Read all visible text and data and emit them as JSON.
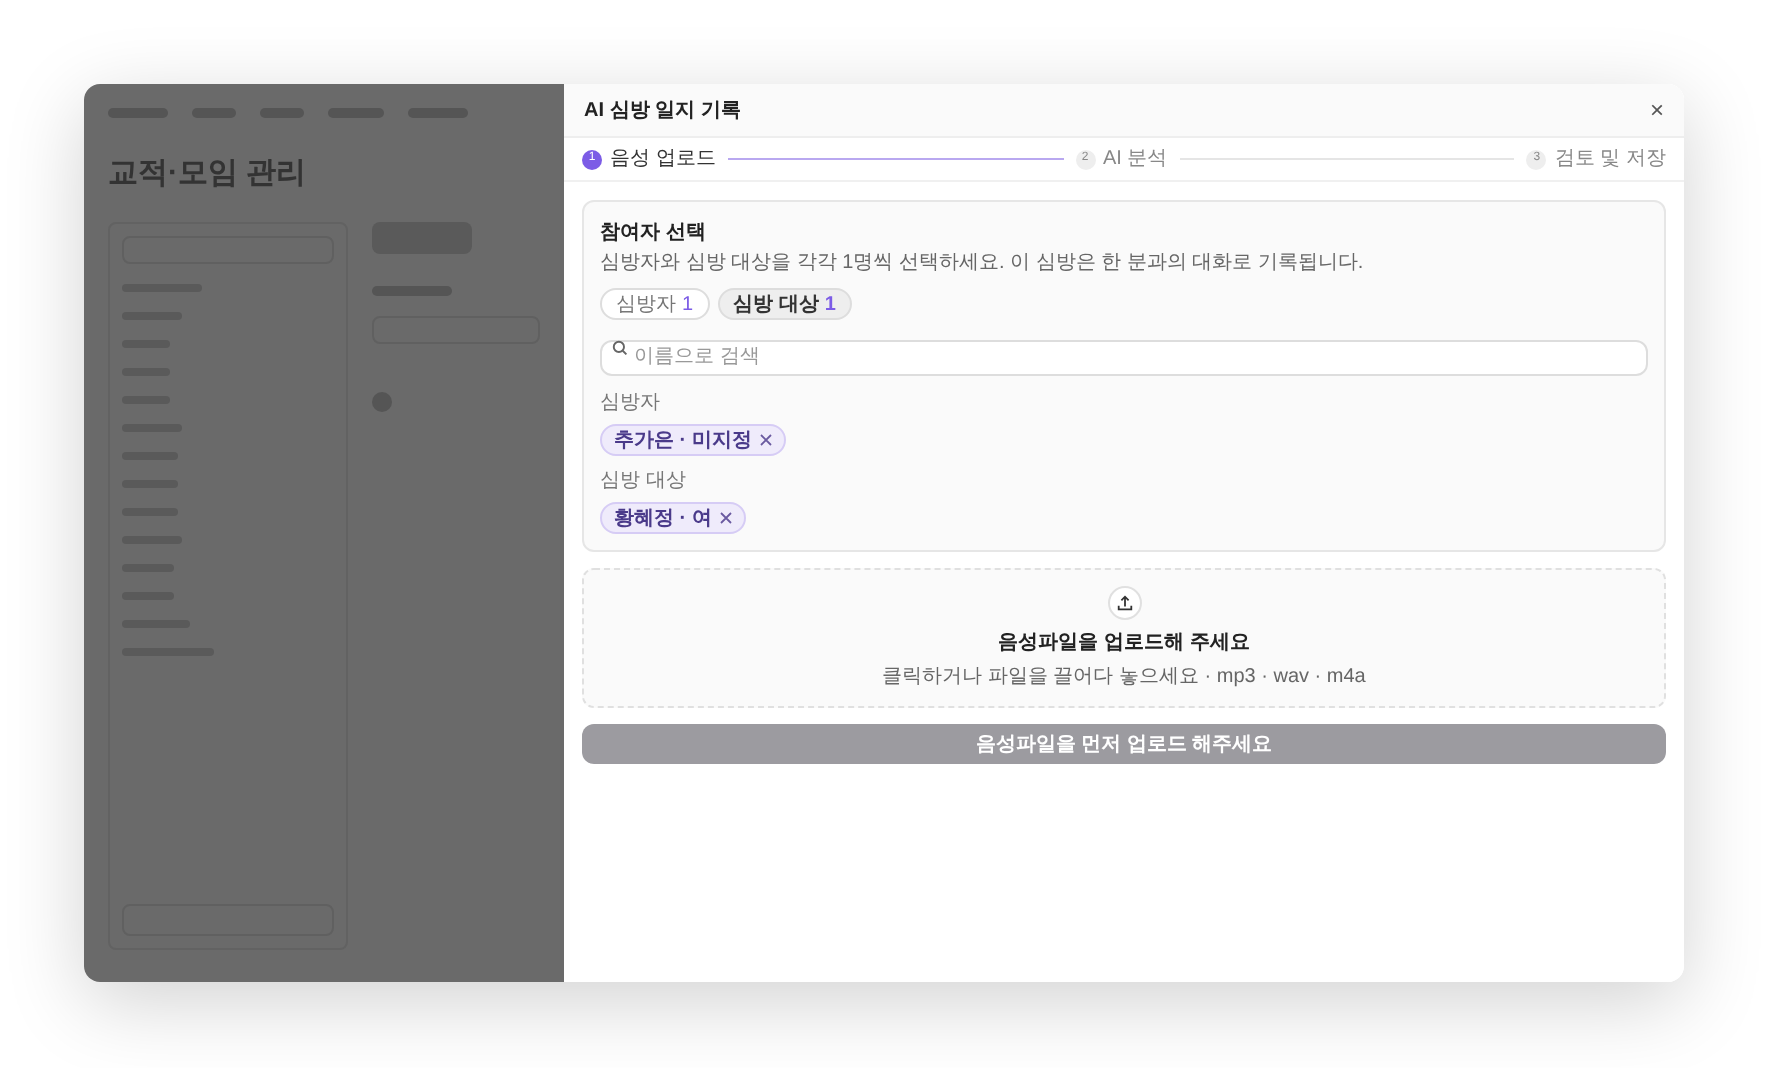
{
  "backdrop": {
    "page_title": "교적·모임 관리"
  },
  "modal": {
    "title": "AI 심방 일지 기록",
    "close": "×"
  },
  "steps": [
    {
      "number": "1",
      "label": "음성 업로드",
      "selected": true
    },
    {
      "number": "2",
      "label": "AI 분석",
      "selected": false
    },
    {
      "number": "3",
      "label": "검토 및 저장",
      "selected": false
    }
  ],
  "participants": {
    "title": "참여자 선택",
    "description": "심방자와 심방 대상을 각각 1명씩 선택하세요. 이 심방은 한 분과의 대화로 기록됩니다.",
    "toggles": [
      {
        "label": "심방자",
        "count": "1",
        "selected": false
      },
      {
        "label": "심방 대상",
        "count": "1",
        "selected": true
      }
    ],
    "search": {
      "placeholder": "이름으로 검색"
    },
    "groups": [
      {
        "label": "심방자",
        "chips": [
          "추가은 · 미지정"
        ]
      },
      {
        "label": "심방 대상",
        "chips": [
          "황혜정 · 여"
        ]
      }
    ]
  },
  "upload": {
    "title": "음성파일을 업로드해 주세요",
    "hint": "클릭하거나 파일을 끌어다 놓으세요 · mp3 · wav · m4a"
  },
  "submit": {
    "label": "음성파일을 먼저 업로드 해주세요",
    "disabled": true
  }
}
